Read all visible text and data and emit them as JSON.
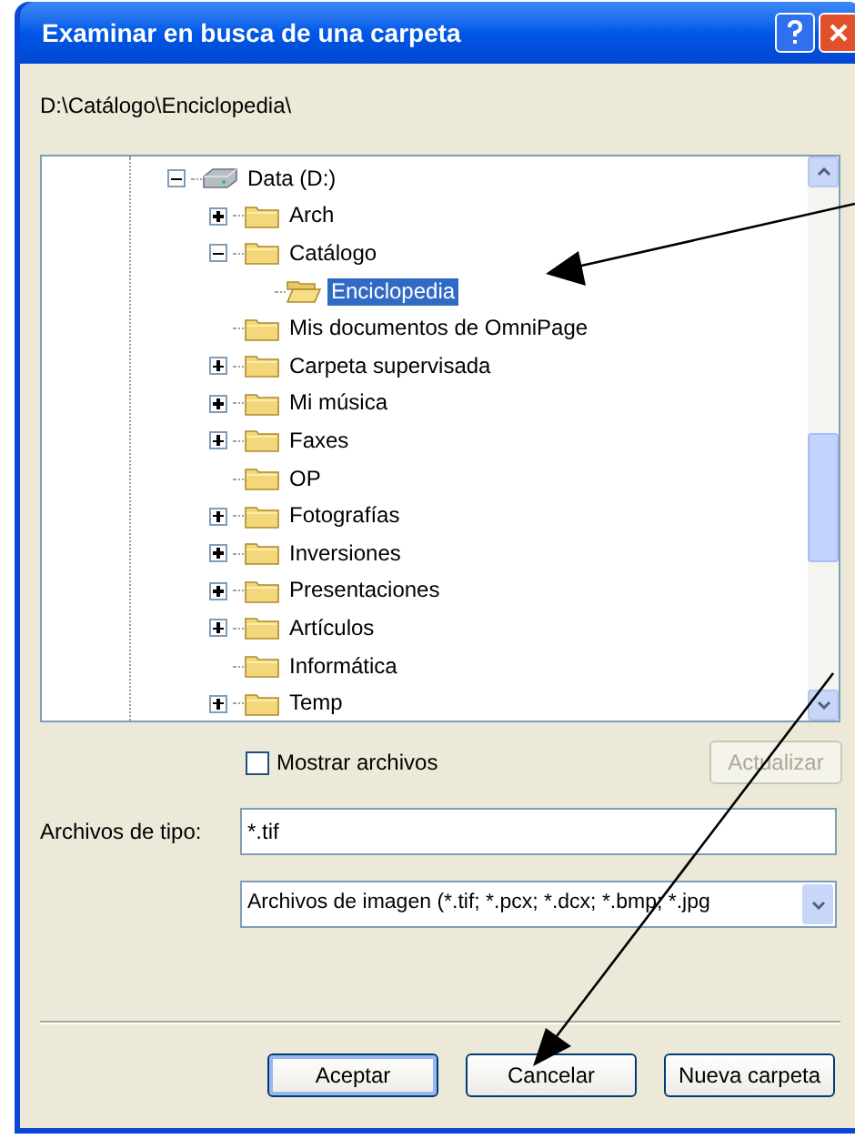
{
  "window": {
    "title": "Examinar en busca de una carpeta"
  },
  "path": "D:\\Catálogo\\Enciclopedia\\",
  "tree": [
    {
      "label": "Data (D:)",
      "kind": "drive",
      "expandable": true,
      "expanded": true,
      "selected": false,
      "children": [
        {
          "label": "Arch",
          "kind": "folder",
          "expandable": true,
          "expanded": false,
          "selected": false
        },
        {
          "label": "Catálogo",
          "kind": "folder",
          "expandable": true,
          "expanded": true,
          "selected": false,
          "children": [
            {
              "label": "Enciclopedia",
              "kind": "open-folder",
              "expandable": false,
              "selected": true
            }
          ]
        },
        {
          "label": "Mis documentos de OmniPage",
          "kind": "folder",
          "expandable": false,
          "selected": false
        },
        {
          "label": "Carpeta supervisada",
          "kind": "folder",
          "expandable": true,
          "expanded": false,
          "selected": false
        },
        {
          "label": "Mi música",
          "kind": "folder",
          "expandable": true,
          "expanded": false,
          "selected": false
        },
        {
          "label": "Faxes",
          "kind": "folder",
          "expandable": true,
          "expanded": false,
          "selected": false
        },
        {
          "label": "OP",
          "kind": "folder",
          "expandable": false,
          "selected": false
        },
        {
          "label": "Fotografías",
          "kind": "folder",
          "expandable": true,
          "expanded": false,
          "selected": false
        },
        {
          "label": "Inversiones",
          "kind": "folder",
          "expandable": true,
          "expanded": false,
          "selected": false
        },
        {
          "label": "Presentaciones",
          "kind": "folder",
          "expandable": true,
          "expanded": false,
          "selected": false
        },
        {
          "label": "Artículos",
          "kind": "folder",
          "expandable": true,
          "expanded": false,
          "selected": false
        },
        {
          "label": "Informática",
          "kind": "folder",
          "expandable": false,
          "selected": false
        },
        {
          "label": "Temp",
          "kind": "folder",
          "expandable": true,
          "expanded": false,
          "selected": false
        }
      ]
    }
  ],
  "show_files": {
    "label": "Mostrar archivos",
    "checked": false
  },
  "refresh_button": {
    "label": "Actualizar",
    "disabled": true
  },
  "file_type": {
    "label": "Archivos de tipo:",
    "value": "*.tif"
  },
  "file_type_select": {
    "value": "Archivos de imagen (*.tif; *.pcx; *.dcx; *.bmp; *.jpg"
  },
  "buttons": [
    {
      "label": "Aceptar",
      "default": true
    },
    {
      "label": "Cancelar",
      "default": false
    },
    {
      "label": "Nueva carpeta",
      "default": false
    }
  ]
}
